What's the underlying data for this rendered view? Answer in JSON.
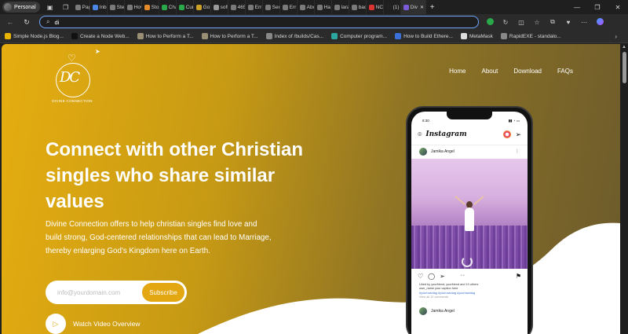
{
  "browser": {
    "profile_label": "Personal",
    "tabs": [
      {
        "label": "Pag",
        "color": "#7a7a7a"
      },
      {
        "label": "Inb",
        "color": "#4b88e6"
      },
      {
        "label": "Step",
        "color": "#7a7a7a"
      },
      {
        "label": "Hov",
        "color": "#7a7a7a"
      },
      {
        "label": "Sto",
        "color": "#e58a2b"
      },
      {
        "label": "Cha",
        "color": "#2aa84a"
      },
      {
        "label": "Cur",
        "color": "#2aa84a"
      },
      {
        "label": "Go",
        "color": "#c9a227"
      },
      {
        "label": "soft",
        "color": "#9a9a9a"
      },
      {
        "label": "465",
        "color": "#7a7a7a"
      },
      {
        "label": "Err",
        "color": "#7a7a7a"
      },
      {
        "label": "Sen",
        "color": "#7a7a7a"
      },
      {
        "label": "Err",
        "color": "#7a7a7a"
      },
      {
        "label": "Abc",
        "color": "#7a7a7a"
      },
      {
        "label": "Ha",
        "color": "#7a7a7a"
      },
      {
        "label": "lara",
        "color": "#7a7a7a"
      },
      {
        "label": "bac",
        "color": "#7a7a7a"
      },
      {
        "label": "NC",
        "color": "#d33"
      },
      {
        "label": "(1)",
        "color": "#222"
      },
      {
        "label": "Div",
        "color": "#7b5bd6"
      }
    ],
    "address_text": "di",
    "bookmarks": [
      {
        "label": "Simple Node.js Blog...",
        "color": "#e8b400"
      },
      {
        "label": "Create a Node Web...",
        "color": "#111111"
      },
      {
        "label": "How to Perform a T...",
        "color": "#9a8f75"
      },
      {
        "label": "How to Perform a T...",
        "color": "#9a8f75"
      },
      {
        "label": "Index of /builds/Cas...",
        "color": "#888888"
      },
      {
        "label": "Computer program...",
        "color": "#2aa8a0"
      },
      {
        "label": "How to Build Ethere...",
        "color": "#3b6fd8"
      },
      {
        "label": "MetaMask",
        "color": "#dddddd"
      },
      {
        "label": "RapidEXE - standalo...",
        "color": "#888888"
      }
    ]
  },
  "site": {
    "logo_brand": "DIVINE CONNECTION",
    "logo_letters": "DC",
    "nav": [
      "Home",
      "About",
      "Download",
      "FAQs"
    ],
    "hero_title": "Connect with other Christian singles who share similar values",
    "hero_text": "Divine Connection offers to help christian singles find love and build strong, God-centered relationships that can lead to Marriage, thereby enlarging God's Kingdom here on Earth.",
    "email_placeholder": "info@yourdomain.com",
    "subscribe_label": "Subscribe",
    "video_label": "Watch Video Overview"
  },
  "phone": {
    "time": "8:30",
    "app_name": "Instagram",
    "post_user": "Jamika Angel",
    "liked_by": "Liked by yourfriend, yourfriend and 10 others",
    "caption": "user_name your caption here",
    "hashtags": "#yourhashtag #yourhashtag #yourhashtag",
    "ago": "View all 12 comments",
    "post2_user": "Jamika Angel"
  }
}
